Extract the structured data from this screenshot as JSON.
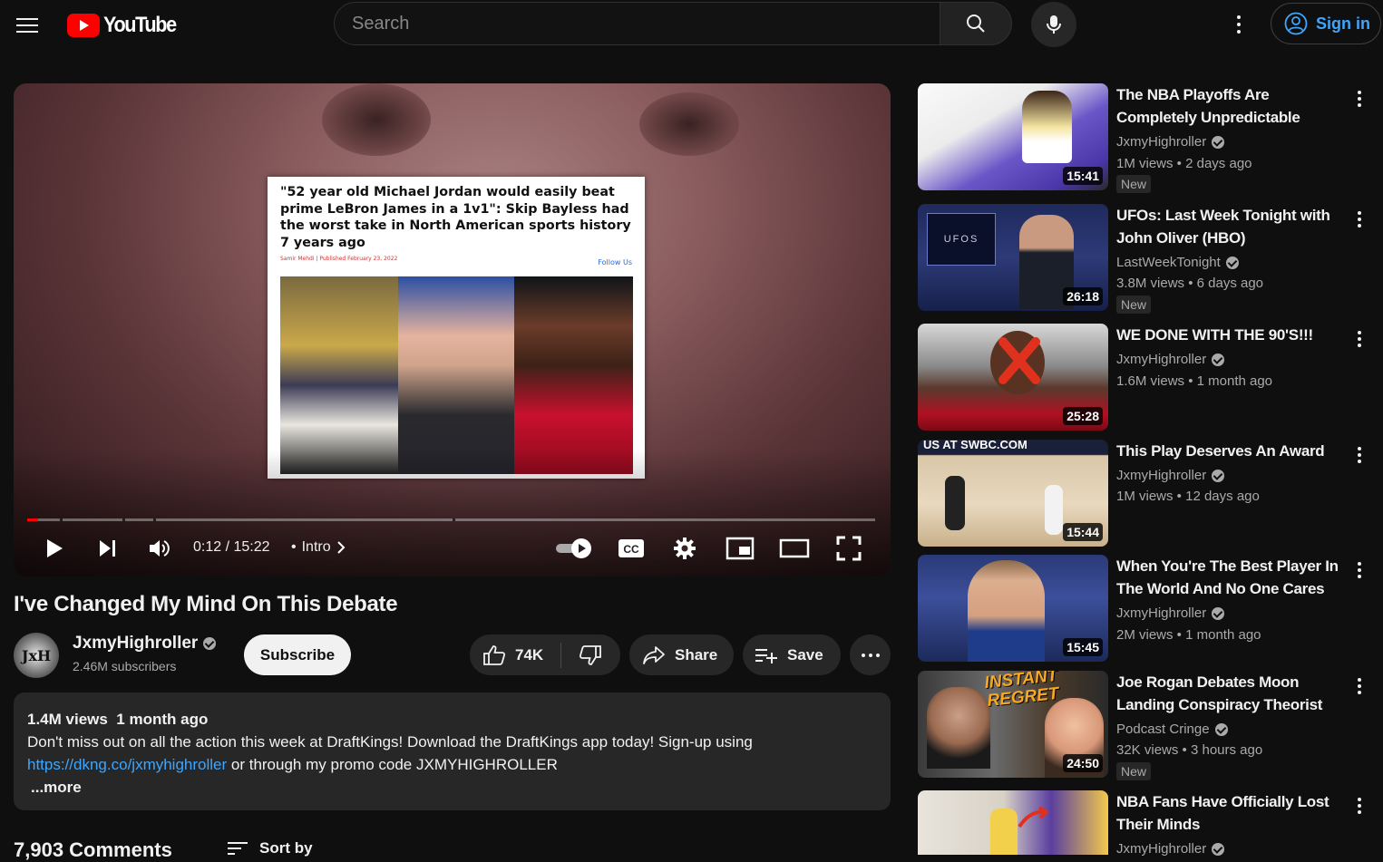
{
  "header": {
    "logo_text": "YouTube",
    "search_placeholder": "Search",
    "signin_label": "Sign in"
  },
  "player": {
    "article_quote": "\"52 year old Michael Jordan would easily beat prime LeBron James in a 1v1\": Skip Bayless had the worst take in North American sports history 7 years ago",
    "article_meta": "Samir Mehdi | Published February 23, 2022",
    "article_follow": "Follow Us",
    "time_current": "0:12",
    "time_separator": "/",
    "time_total": "15:22",
    "chapter_label": "Intro",
    "progress_fraction": 0.013,
    "cc_label": "CC"
  },
  "video": {
    "title": "I've Changed My Mind On This Debate",
    "channel_name": "JxmyHighroller",
    "channel_avatar_text": "JxH",
    "subscribers": "2.46M subscribers",
    "subscribe_label": "Subscribe",
    "likes": "74K",
    "share_label": "Share",
    "save_label": "Save"
  },
  "description": {
    "views": "1.4M views",
    "date": "1 month ago",
    "line1": "Don't miss out on all the action this week at DraftKings! Download the DraftKings app today! Sign-up using",
    "link": "https://dkng.co/jxmyhighroller",
    "line2_rest": " or through my promo code JXMYHIGHROLLER",
    "more_label": "...more"
  },
  "comments": {
    "count_label": "7,903 Comments",
    "sort_label": "Sort by"
  },
  "recommendations": [
    {
      "title": "The NBA Playoffs Are Completely Unpredictable",
      "channel": "JxmyHighroller",
      "views": "1M views",
      "age": "2 days ago",
      "badge": "New",
      "duration": "15:41"
    },
    {
      "title": "UFOs: Last Week Tonight with John Oliver (HBO)",
      "channel": "LastWeekTonight",
      "views": "3.8M views",
      "age": "6 days ago",
      "badge": "New",
      "duration": "26:18"
    },
    {
      "title": "WE DONE WITH THE 90'S!!!",
      "channel": "JxmyHighroller",
      "views": "1.6M views",
      "age": "1 month ago",
      "badge": "",
      "duration": "25:28"
    },
    {
      "title": "This Play Deserves An Award",
      "channel": "JxmyHighroller",
      "views": "1M views",
      "age": "12 days ago",
      "badge": "",
      "duration": "15:44"
    },
    {
      "title": "When You're The Best Player In The World And No One Cares",
      "channel": "JxmyHighroller",
      "views": "2M views",
      "age": "1 month ago",
      "badge": "",
      "duration": "15:45"
    },
    {
      "title": "Joe Rogan Debates Moon Landing Conspiracy Theorist",
      "channel": "Podcast Cringe",
      "views": "32K views",
      "age": "3 hours ago",
      "badge": "New",
      "duration": "24:50",
      "thumb_text": "INSTANT REGRET"
    },
    {
      "title": "NBA Fans Have Officially Lost Their Minds",
      "channel": "JxmyHighroller",
      "views": "",
      "age": "",
      "badge": "",
      "duration": ""
    }
  ],
  "thumb_texts": {
    "ufo_overlay": "UFOS",
    "sports_banner": "US AT SWBC.COM"
  },
  "colors": {
    "background": "#0f0f0f",
    "brand_red": "#ff0000",
    "link_blue": "#3ea6ff",
    "pill": "#272727"
  }
}
